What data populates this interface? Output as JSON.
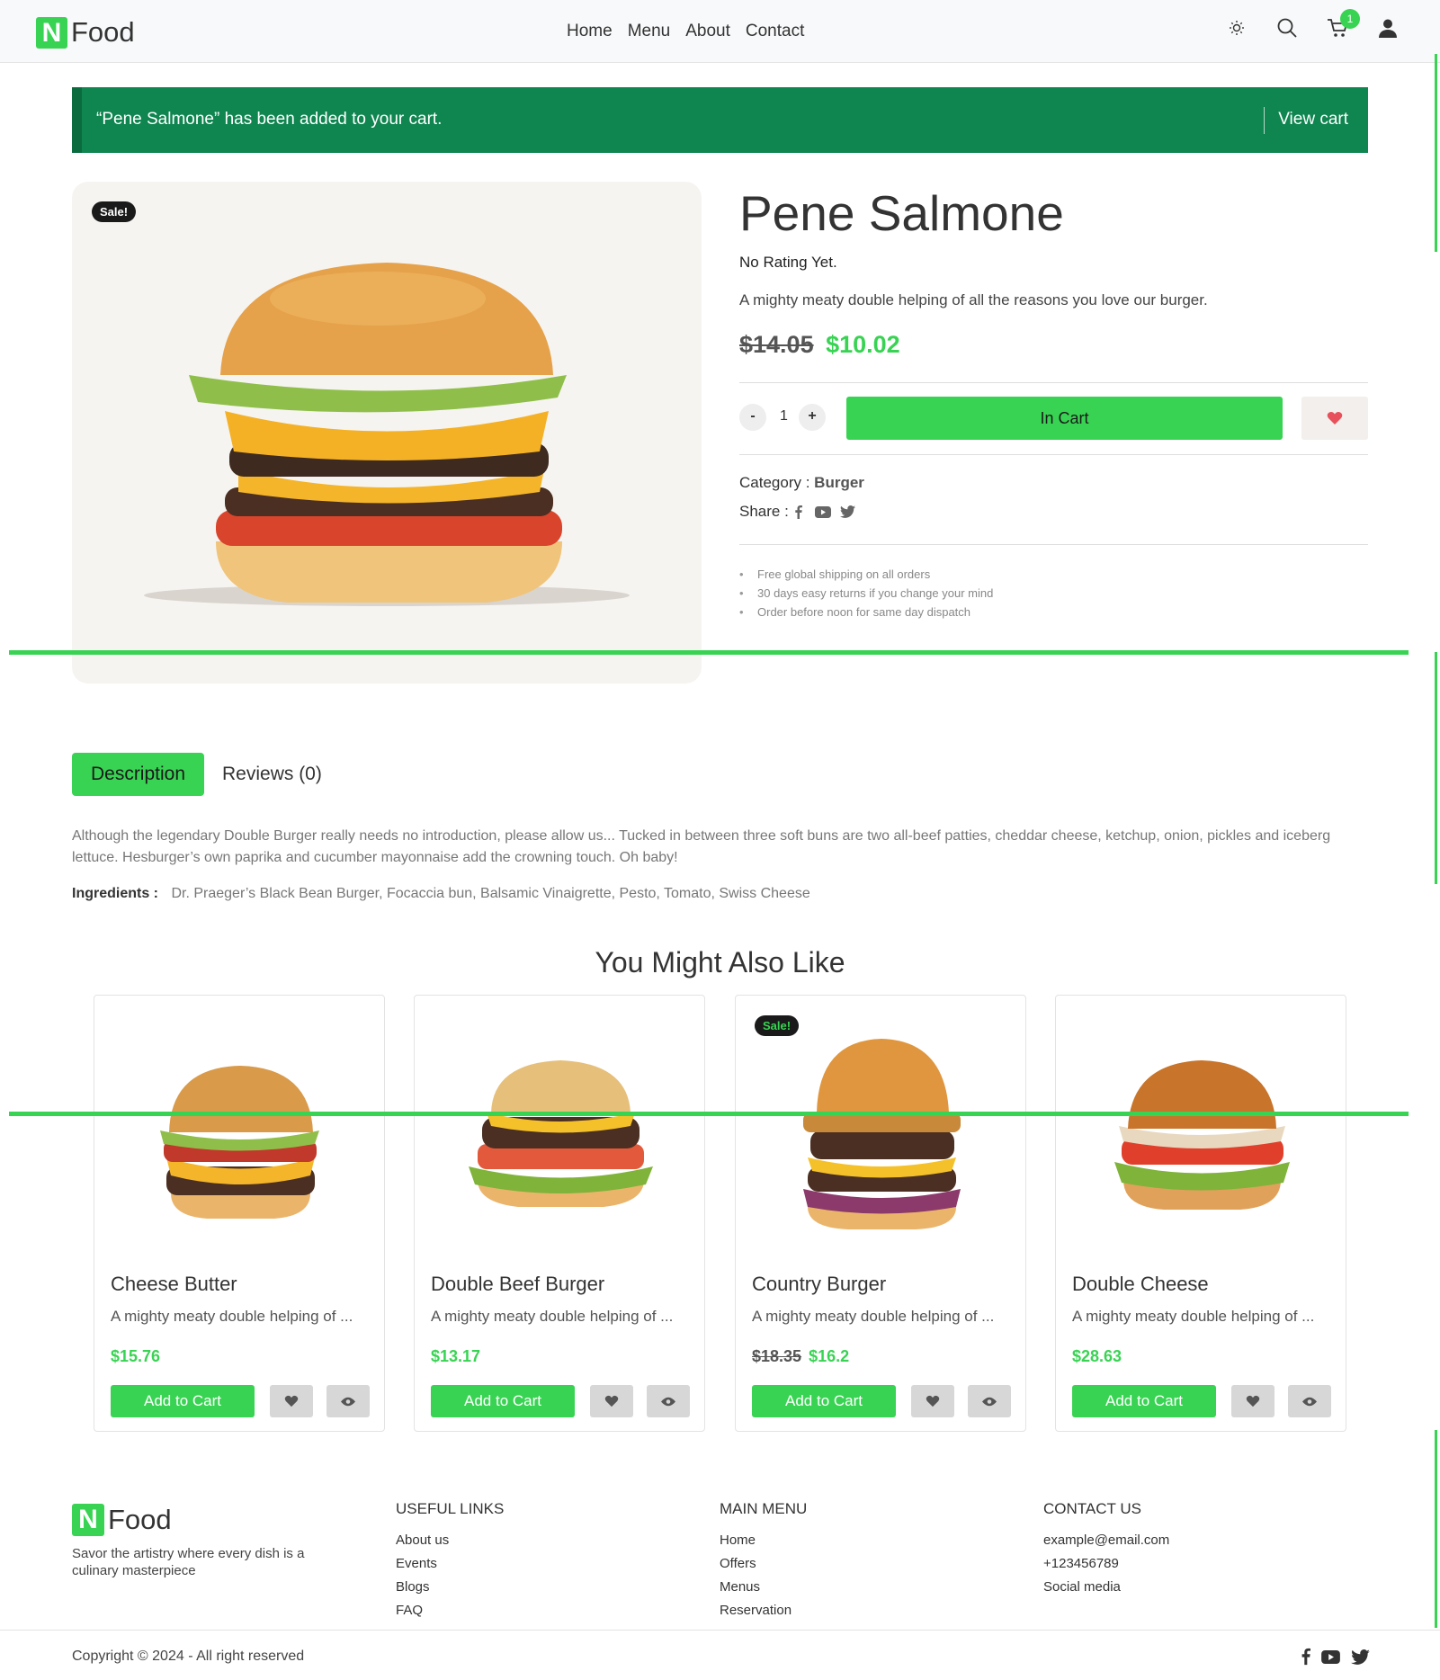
{
  "brand": {
    "logo_letter": "N",
    "logo_text": "Food"
  },
  "nav": [
    "Home",
    "Menu",
    "About",
    "Contact"
  ],
  "header": {
    "cart_count": "1"
  },
  "notice": {
    "message": "“Pene Salmone” has been added to your cart.",
    "link": "View cart"
  },
  "product": {
    "sale_badge": "Sale!",
    "name": "Pene Salmone",
    "rating": "No Rating Yet.",
    "short_desc": "A mighty meaty double helping of all the reasons you love our burger.",
    "old_price": "$14.05",
    "price": "$10.02",
    "qty_minus": "-",
    "qty": "1",
    "qty_plus": "+",
    "cart_button": "In Cart",
    "category_label": "Category :",
    "category": "Burger",
    "share_label": "Share :",
    "perks": [
      "Free global shipping on all orders",
      "30 days easy returns if you change your mind",
      "Order before noon for same day dispatch"
    ]
  },
  "tabs": {
    "description": "Description",
    "reviews": "Reviews (0)"
  },
  "description": {
    "text": "Although the legendary Double Burger really needs no introduction, please allow us... Tucked in between three soft buns are two all-beef patties, cheddar cheese, ketchup, onion, pickles and iceberg lettuce. Hesburger’s own paprika and cucumber mayonnaise add the crowning touch. Oh baby!",
    "ingredients_label": "Ingredients :",
    "ingredients": "Dr. Praeger’s Black Bean Burger, Focaccia bun, Balsamic Vinaigrette, Pesto, Tomato, Swiss Cheese"
  },
  "related": {
    "title": "You Might Also Like",
    "add_label": "Add to Cart",
    "items": [
      {
        "name": "Cheese Butter",
        "desc": "A mighty meaty double helping of ...",
        "old_price": "",
        "price": "$15.76",
        "sale": ""
      },
      {
        "name": "Double Beef Burger",
        "desc": "A mighty meaty double helping of ...",
        "old_price": "",
        "price": "$13.17",
        "sale": ""
      },
      {
        "name": "Country Burger",
        "desc": "A mighty meaty double helping of ...",
        "old_price": "$18.35",
        "price": "$16.2",
        "sale": "Sale!"
      },
      {
        "name": "Double Cheese",
        "desc": "A mighty meaty double helping of ...",
        "old_price": "",
        "price": "$28.63",
        "sale": ""
      }
    ]
  },
  "footer": {
    "tagline": "Savor the artistry where every dish is a culinary masterpiece",
    "useful_links": {
      "title": "USEFUL LINKS",
      "items": [
        "About us",
        "Events",
        "Blogs",
        "FAQ"
      ]
    },
    "main_menu": {
      "title": "MAIN MENU",
      "items": [
        "Home",
        "Offers",
        "Menus",
        "Reservation"
      ]
    },
    "contact": {
      "title": "CONTACT US",
      "items": [
        "example@email.com",
        "+123456789",
        "Social media"
      ]
    },
    "copyright": "Copyright © 2024 - All right reserved"
  },
  "colors": {
    "accent": "#39d353",
    "notice_bg": "#0f8550",
    "heart": "#e8505b"
  },
  "icons": [
    "sun-icon",
    "search-icon",
    "cart-icon",
    "user-icon",
    "heart-icon",
    "eye-icon",
    "facebook-icon",
    "youtube-icon",
    "twitter-icon"
  ]
}
